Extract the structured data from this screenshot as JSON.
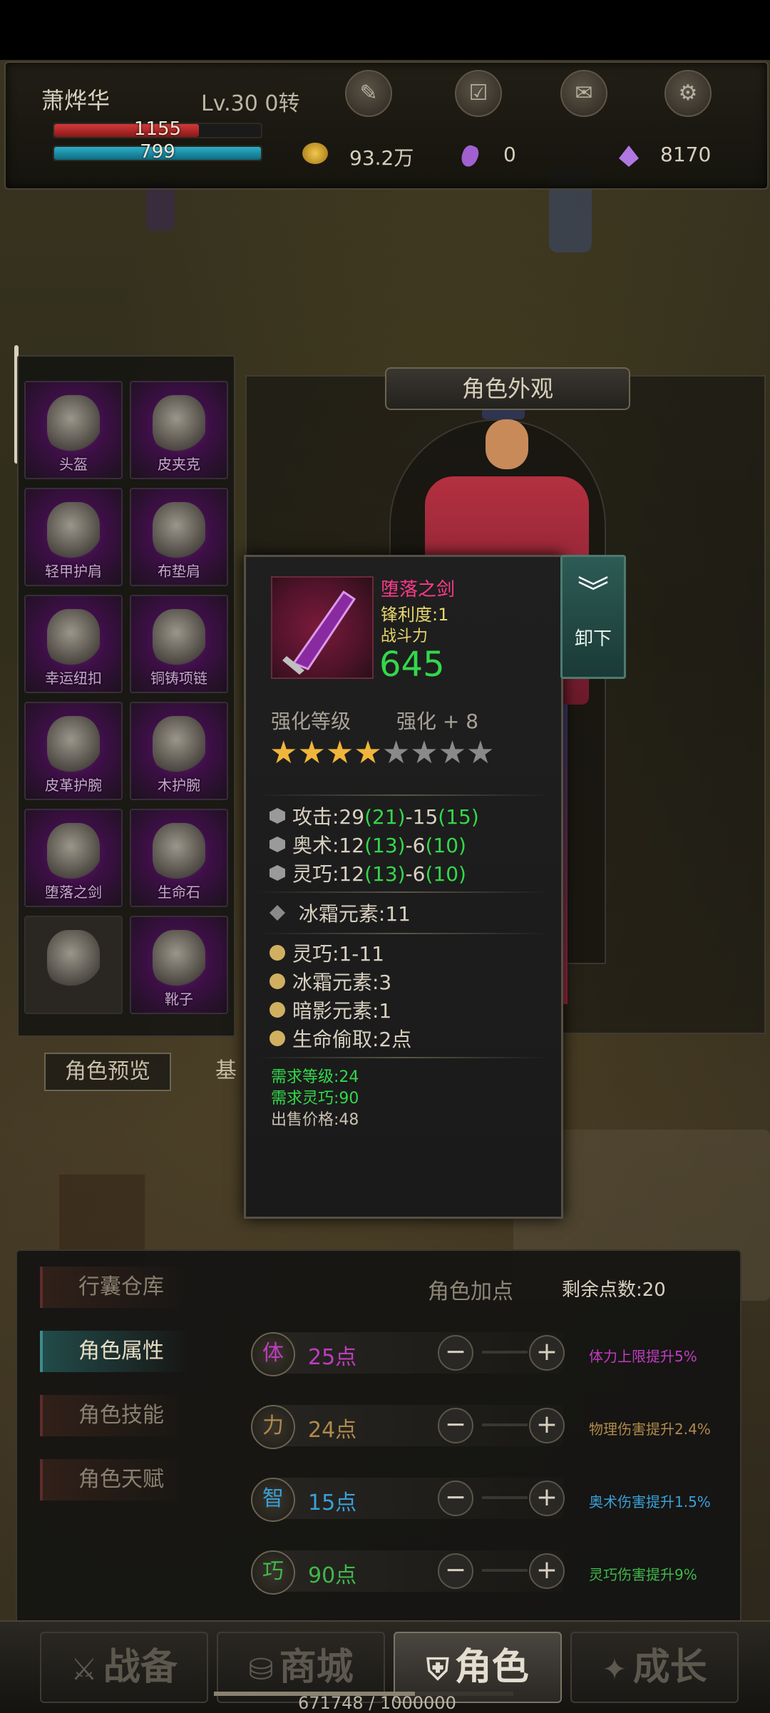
{
  "header": {
    "player_name": "萧烨华",
    "level": "Lv.30 0转",
    "hp": "1155",
    "hp_fraction": 0.7,
    "mp": "799",
    "mp_fraction": 1.0,
    "icons": [
      "quest-scroll-icon",
      "checklist-icon",
      "mail-icon",
      "settings-gear-icon"
    ],
    "gold": "93.2万",
    "crystal": "0",
    "gem": "8170"
  },
  "equipment": {
    "slots": [
      {
        "label": "头盔",
        "icon": "helmet-icon"
      },
      {
        "label": "皮夹克",
        "icon": "leather-jacket-icon"
      },
      {
        "label": "轻甲护肩",
        "icon": "pauldron-icon"
      },
      {
        "label": "布垫肩",
        "icon": "cloth-shoulder-icon"
      },
      {
        "label": "幸运纽扣",
        "icon": "lucky-button-necklace-icon"
      },
      {
        "label": "铜铸项链",
        "icon": "copper-chain-icon"
      },
      {
        "label": "皮革护腕",
        "icon": "leather-bracer-icon"
      },
      {
        "label": "木护腕",
        "icon": "wooden-bracer-icon"
      },
      {
        "label": "堕落之剑",
        "icon": "sword-icon"
      },
      {
        "label": "生命石",
        "icon": "life-stone-icon"
      },
      {
        "label": "",
        "icon": "empty-belt-slot-icon"
      },
      {
        "label": "靴子",
        "icon": "boots-icon"
      }
    ],
    "preview_tab": "角色预览",
    "base_tab_partial": "基"
  },
  "appearance": {
    "title": "角色外观"
  },
  "tooltip": {
    "item_name": "堕落之剑",
    "sharpness": "锋利度:1",
    "power_label": "战斗力",
    "power": "645",
    "enhance_label": "强化等级",
    "enhance_value": "强化 + 8",
    "stars_filled": 4,
    "stars_total": 8,
    "base_stats": [
      {
        "name": "攻击:29",
        "b1": "(21)",
        "mid": "-15",
        "b2": "(15)"
      },
      {
        "name": "奥术:12",
        "b1": "(13)",
        "mid": "-6",
        "b2": "(10)"
      },
      {
        "name": "灵巧:12",
        "b1": "(13)",
        "mid": "-6",
        "b2": "(10)"
      }
    ],
    "element_stat": "冰霜元素:11",
    "affixes": [
      "灵巧:1-11",
      "冰霜元素:3",
      "暗影元素:1",
      "生命偷取:2点"
    ],
    "req_level": "需求等级:24",
    "req_dex": "需求灵巧:90",
    "sell_price": "出售价格:48",
    "unload_label": "卸下"
  },
  "bottom_panel": {
    "side_tabs": [
      "行囊仓库",
      "角色属性",
      "角色技能",
      "角色天赋"
    ],
    "active_tab": 1,
    "section_title": "角色加点",
    "remaining": "剩余点数:20",
    "attributes": [
      {
        "badge": "体",
        "points": "25点",
        "desc": "体力上限提升5%",
        "color": "#c03cc0"
      },
      {
        "badge": "力",
        "points": "24点",
        "desc": "物理伤害提升2.4%",
        "color": "#b08a4a"
      },
      {
        "badge": "智",
        "points": "15点",
        "desc": "奥术伤害提升1.5%",
        "color": "#3aa0d8"
      },
      {
        "badge": "巧",
        "points": "90点",
        "desc": "灵巧伤害提升9%",
        "color": "#3fb84a"
      }
    ],
    "minus": "−",
    "plus": "+"
  },
  "nav": {
    "tabs": [
      "战备",
      "商城",
      "角色",
      "成长"
    ],
    "active": 2,
    "exp_text": "671748 / 1000000",
    "exp_fraction": 0.6717
  },
  "colors": {
    "purple_slot": "#6b1e79",
    "green_value": "#33d84a",
    "item_name": "#ff3a8a",
    "sharpness": "#e6d66a"
  }
}
